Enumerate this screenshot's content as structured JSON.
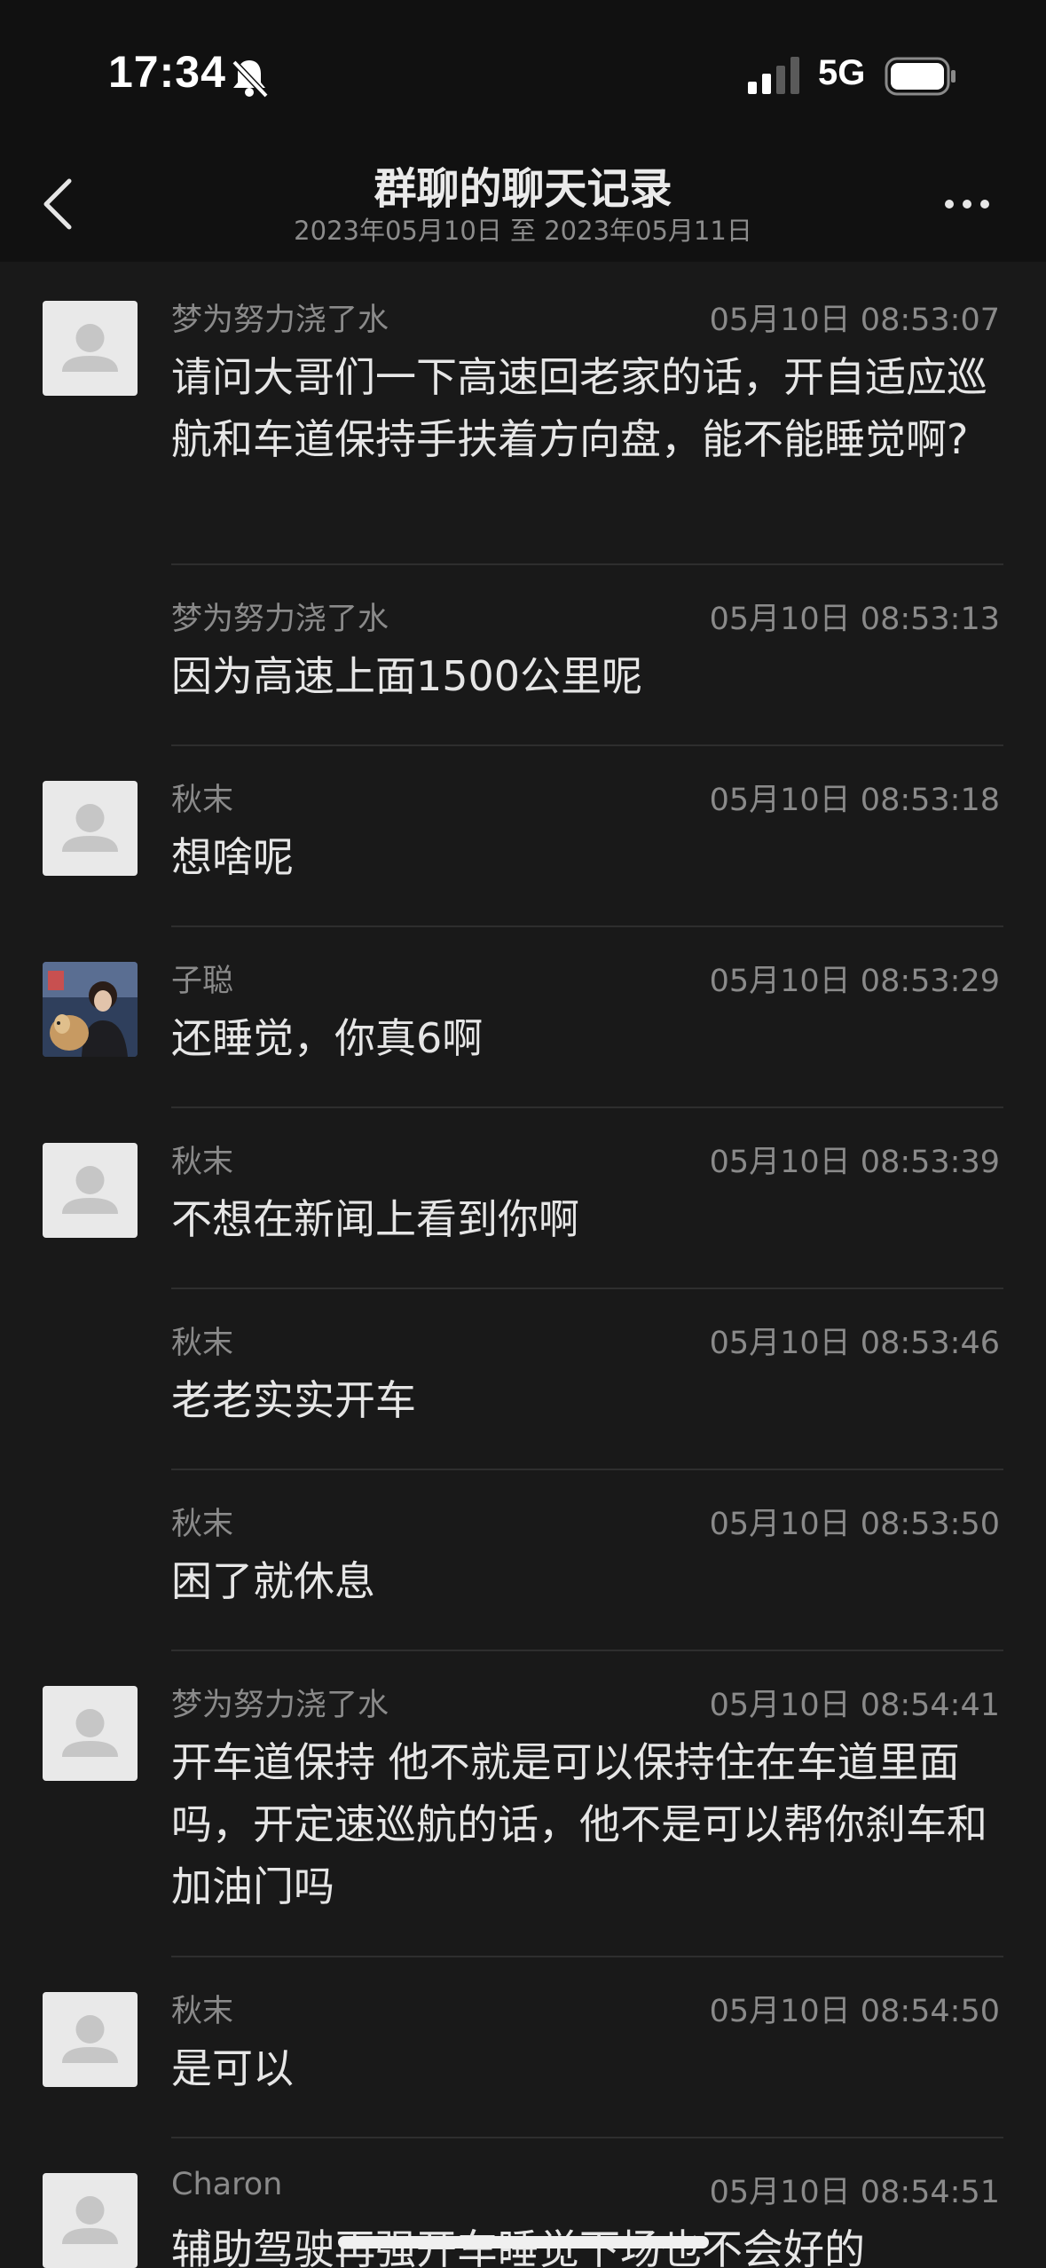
{
  "status_bar": {
    "time": "17:34",
    "network": "5G"
  },
  "header": {
    "title": "群聊的聊天记录",
    "subtitle": "2023年05月10日 至 2023年05月11日"
  },
  "messages": [
    {
      "sender": "梦为努力浇了水",
      "time": "05月10日 08:53:07",
      "text": "请问大哥们一下高速回老家的话，开自适应巡航和车道保持手扶着方向盘，能不能睡觉啊?",
      "avatar": "default"
    },
    {
      "sender": "梦为努力浇了水",
      "time": "05月10日 08:53:13",
      "text": "因为高速上面1500公里呢",
      "avatar": "none"
    },
    {
      "sender": "秋末",
      "time": "05月10日 08:53:18",
      "text": "想啥呢",
      "avatar": "default"
    },
    {
      "sender": "子聪",
      "time": "05月10日 08:53:29",
      "text": "还睡觉，你真6啊",
      "avatar": "photo"
    },
    {
      "sender": "秋末",
      "time": "05月10日 08:53:39",
      "text": "不想在新闻上看到你啊",
      "avatar": "default"
    },
    {
      "sender": "秋末",
      "time": "05月10日 08:53:46",
      "text": "老老实实开车",
      "avatar": "none"
    },
    {
      "sender": "秋末",
      "time": "05月10日 08:53:50",
      "text": "困了就休息",
      "avatar": "none"
    },
    {
      "sender": "梦为努力浇了水",
      "time": "05月10日 08:54:41",
      "text": "开车道保持 他不就是可以保持住在车道里面吗，开定速巡航的话，他不是可以帮你刹车和加油门吗",
      "avatar": "default"
    },
    {
      "sender": "秋末",
      "time": "05月10日 08:54:50",
      "text": "是可以",
      "avatar": "default"
    },
    {
      "sender": "Charon",
      "time": "05月10日 08:54:51",
      "text": "辅助驾驶再强开车睡觉下场也不会好的",
      "avatar": "default"
    }
  ]
}
